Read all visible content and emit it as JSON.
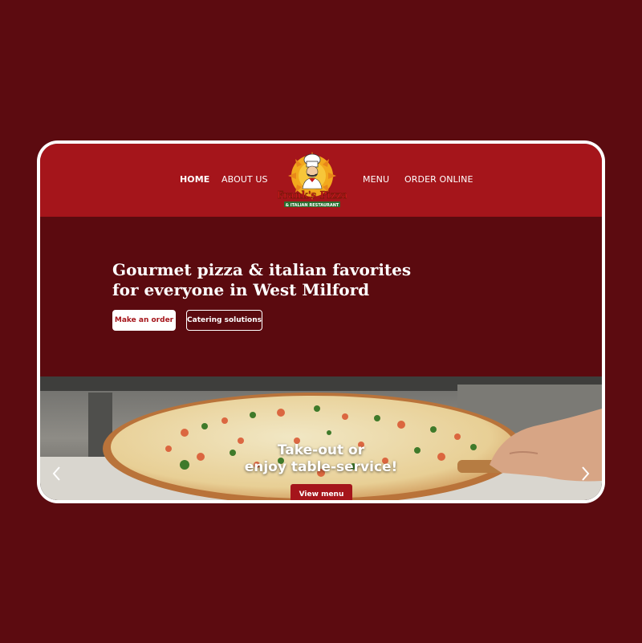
{
  "nav": {
    "home": "HOME",
    "about": "ABOUT US",
    "menu": "MENU",
    "order_online": "ORDER ONLINE"
  },
  "logo": {
    "name": "Frank's Pizza",
    "tagline": "& ITALIAN RESTAURANT"
  },
  "hero": {
    "title": "Gourmet pizza & italian favorites for everyone in West Milford",
    "primary_button": "Make an order",
    "secondary_button": "Catering solutions"
  },
  "slider": {
    "line1": "Take-out or",
    "line2": "enjoy table-service!",
    "button": "View menu",
    "prev_icon": "chevron-left-icon",
    "next_icon": "chevron-right-icon"
  },
  "colors": {
    "background": "#5c0b10",
    "header": "#a5151b",
    "hero": "#5b0a0f",
    "accent": "#a5151b"
  }
}
